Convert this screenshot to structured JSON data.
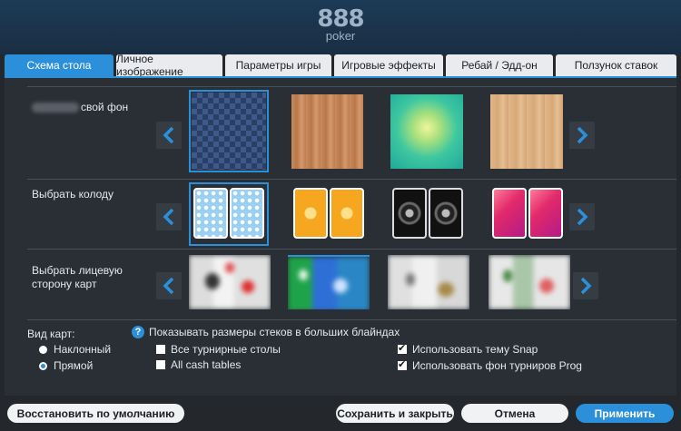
{
  "logo": {
    "number": "888",
    "sub": "poker"
  },
  "tabs": [
    {
      "label": "Схема стола",
      "active": true
    },
    {
      "label": "Личное изображение",
      "active": false
    },
    {
      "label": "Параметры игры",
      "active": false
    },
    {
      "label": "Игровые эффекты",
      "active": false
    },
    {
      "label": "Ребай / Эдд-он",
      "active": false
    },
    {
      "label": "Ползунок ставок",
      "active": false
    }
  ],
  "rows": {
    "background": {
      "label": "свой фон",
      "selected_index": 0
    },
    "deck": {
      "label": "Выбрать колоду",
      "selected_index": 0
    },
    "face": {
      "label": "Выбрать лицевую сторону карт",
      "label_line1": "Выбрать лицевую",
      "label_line2": "сторону карт",
      "selected_index": 1
    }
  },
  "card_view": {
    "label": "Вид карт:",
    "options": [
      {
        "label": "Наклонный",
        "selected": false
      },
      {
        "label": "Прямой",
        "selected": true
      }
    ]
  },
  "options": {
    "show_stacks": "Показывать размеры стеков в больших блайндах",
    "all_tournament_tables": {
      "label": "Все турнирные столы",
      "checked": false
    },
    "all_cash_tables": {
      "label": "All cash tables",
      "checked": false
    },
    "use_snap_theme": {
      "label": "Использовать тему Snap",
      "checked": true
    },
    "use_prog_background": {
      "label": "Использовать фон турниров Prog",
      "checked": true
    }
  },
  "buttons": {
    "restore_defaults": "Восстановить по умолчанию",
    "save_close": "Сохранить и закрыть",
    "cancel": "Отмена",
    "apply": "Применить"
  },
  "colors": {
    "accent": "#2b90d9",
    "panel": "#2a2f35",
    "header": "#1c3a56"
  },
  "icons": {
    "prev": "chevron-left-icon",
    "next": "chevron-right-icon",
    "help": "help-icon"
  }
}
